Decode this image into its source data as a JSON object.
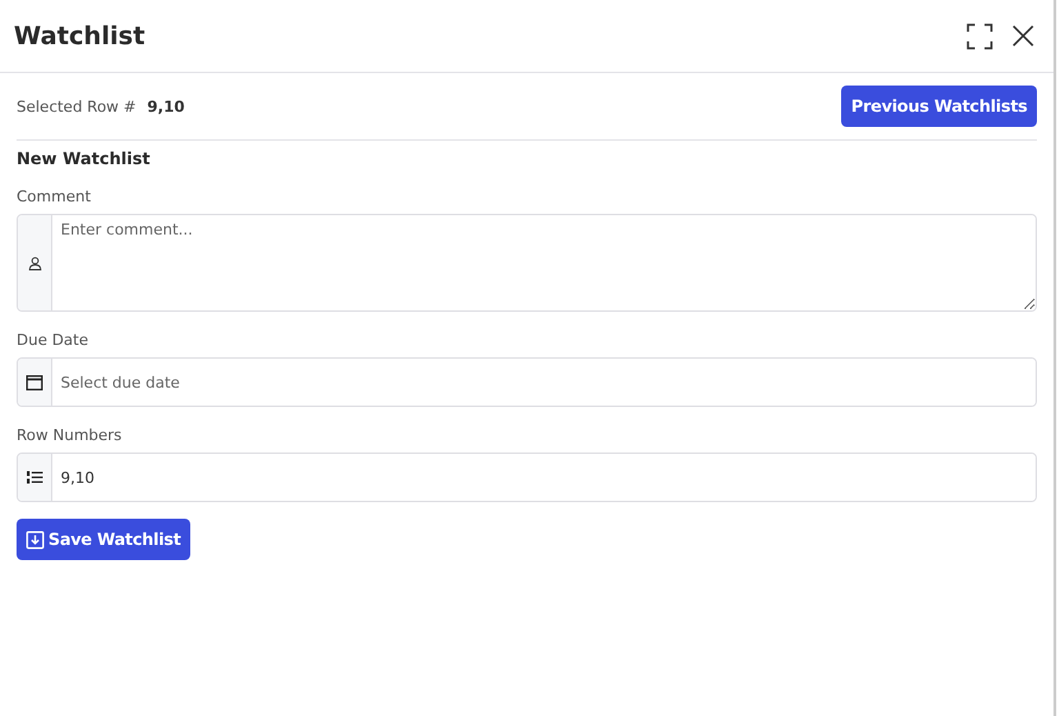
{
  "window": {
    "title": "Watchlist"
  },
  "selected_row": {
    "label": "Selected Row #",
    "value": "9,10"
  },
  "previous_button": "Previous Watchlists",
  "section_title": "New Watchlist",
  "fields": [
    {
      "kind": "comment",
      "label": "Comment",
      "placeholder": "Enter comment..."
    },
    {
      "kind": "date",
      "label": "Due Date",
      "placeholder": "Select due date"
    },
    {
      "kind": "rows",
      "label": "Row Numbers",
      "value": "9,10"
    }
  ],
  "save_button": "Save Watchlist"
}
